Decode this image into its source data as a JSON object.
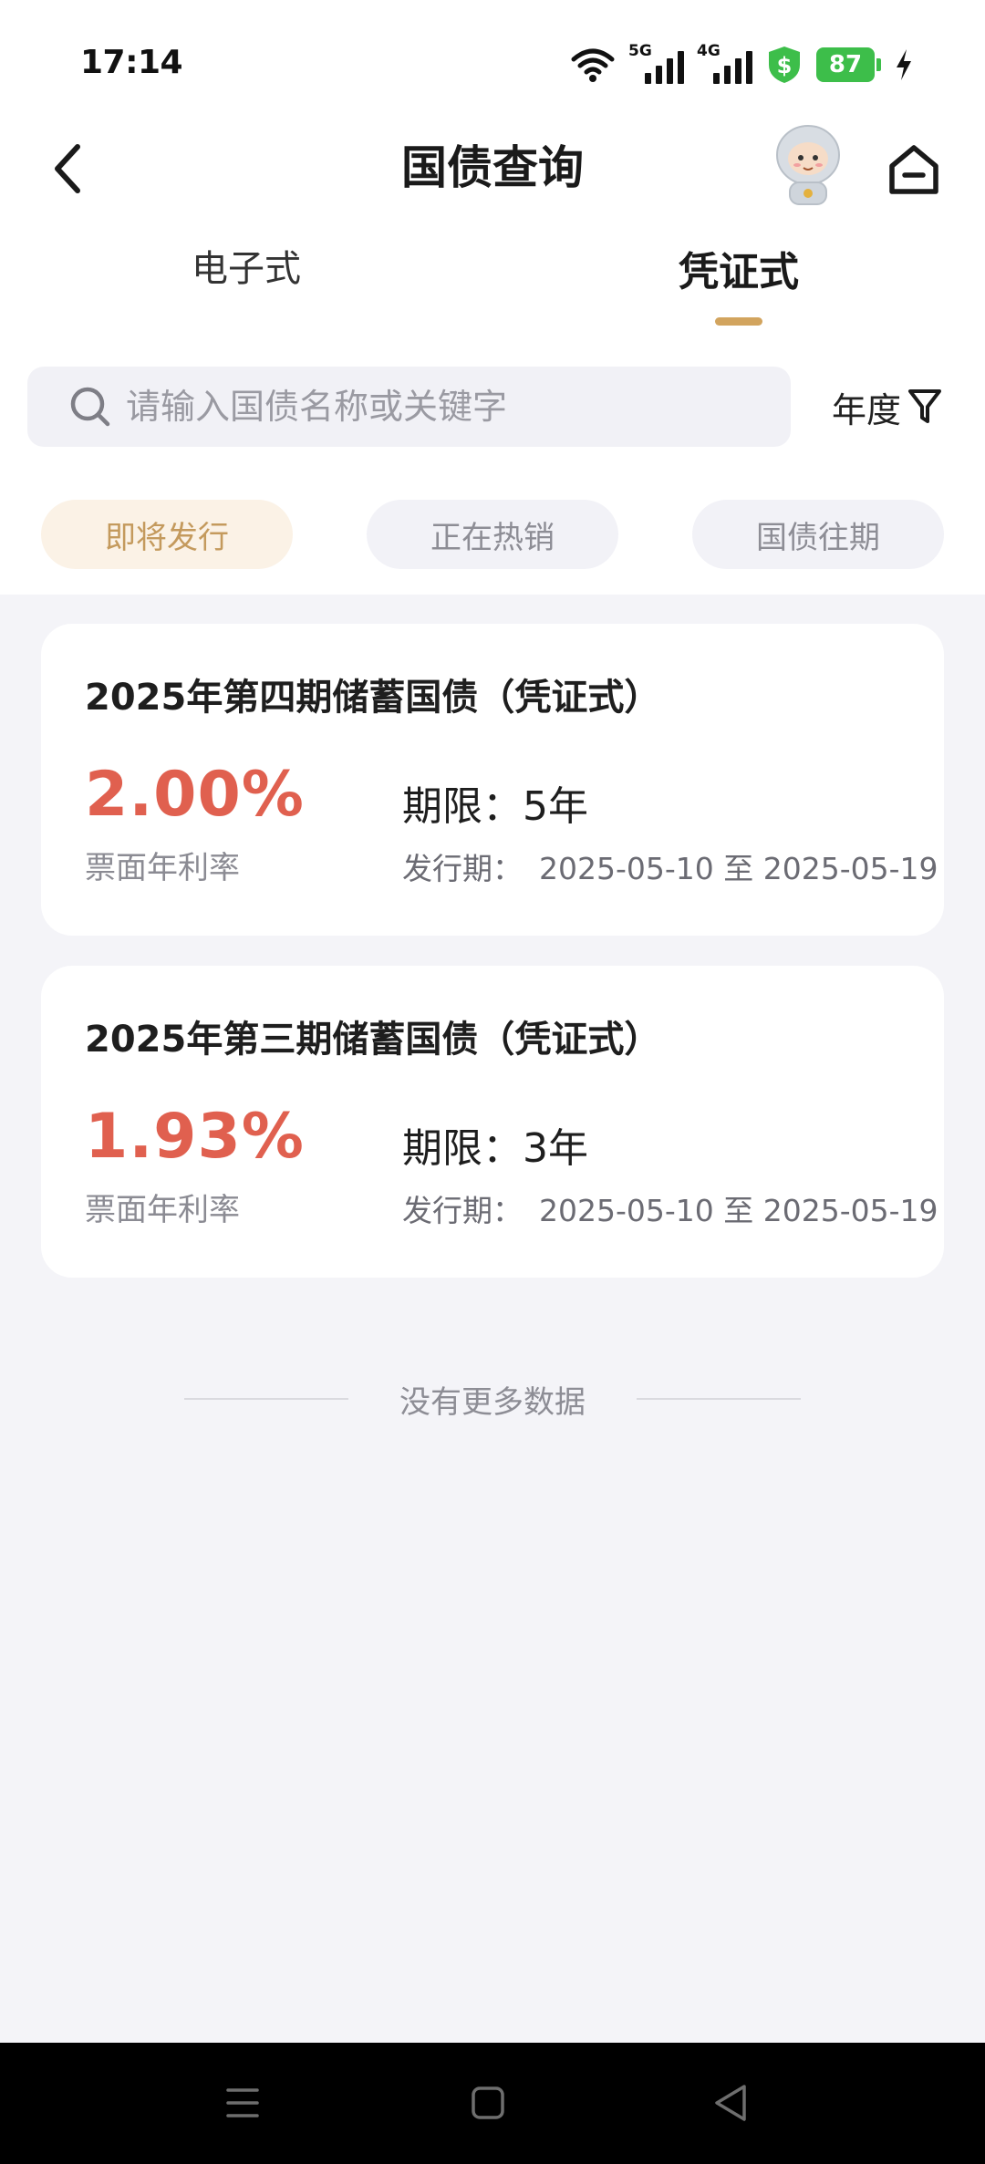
{
  "status_bar": {
    "time": "17:14",
    "network_1": "5G",
    "network_2": "4G",
    "battery": "87",
    "icons": [
      "wifi-icon",
      "signal-icon",
      "shield-dollar-icon",
      "battery-icon",
      "charging-icon"
    ]
  },
  "header": {
    "title": "国债查询",
    "back_icon": "chevron-left-icon",
    "home_icon": "home-icon",
    "mascot": "astronaut-mascot"
  },
  "tabs": [
    {
      "label": "电子式",
      "active": false
    },
    {
      "label": "凭证式",
      "active": true
    }
  ],
  "search": {
    "placeholder": "请输入国债名称或关键字",
    "value": "",
    "filter_label": "年度",
    "filter_icon": "filter-icon"
  },
  "chips": [
    {
      "label": "即将发行",
      "active": true
    },
    {
      "label": "正在热销",
      "active": false
    },
    {
      "label": "国债往期",
      "active": false
    }
  ],
  "bonds": [
    {
      "name": "2025年第四期储蓄国债（凭证式）",
      "rate": "2.00%",
      "rate_label": "票面年利率",
      "term": "期限：5年",
      "period_label": "发行期：",
      "period_value": "2025-05-10 至 2025-05-19"
    },
    {
      "name": "2025年第三期储蓄国债（凭证式）",
      "rate": "1.93%",
      "rate_label": "票面年利率",
      "term": "期限：3年",
      "period_label": "发行期：",
      "period_value": "2025-05-10 至 2025-05-19"
    }
  ],
  "footer": {
    "no_more": "没有更多数据"
  },
  "colors": {
    "accent": "#D2A45E",
    "rate": "#E0604F",
    "chip_active_bg": "#FBF2E6",
    "chip_active_text": "#C49A5D",
    "page_bg": "#F4F4F8",
    "battery": "#3DBE4A"
  }
}
